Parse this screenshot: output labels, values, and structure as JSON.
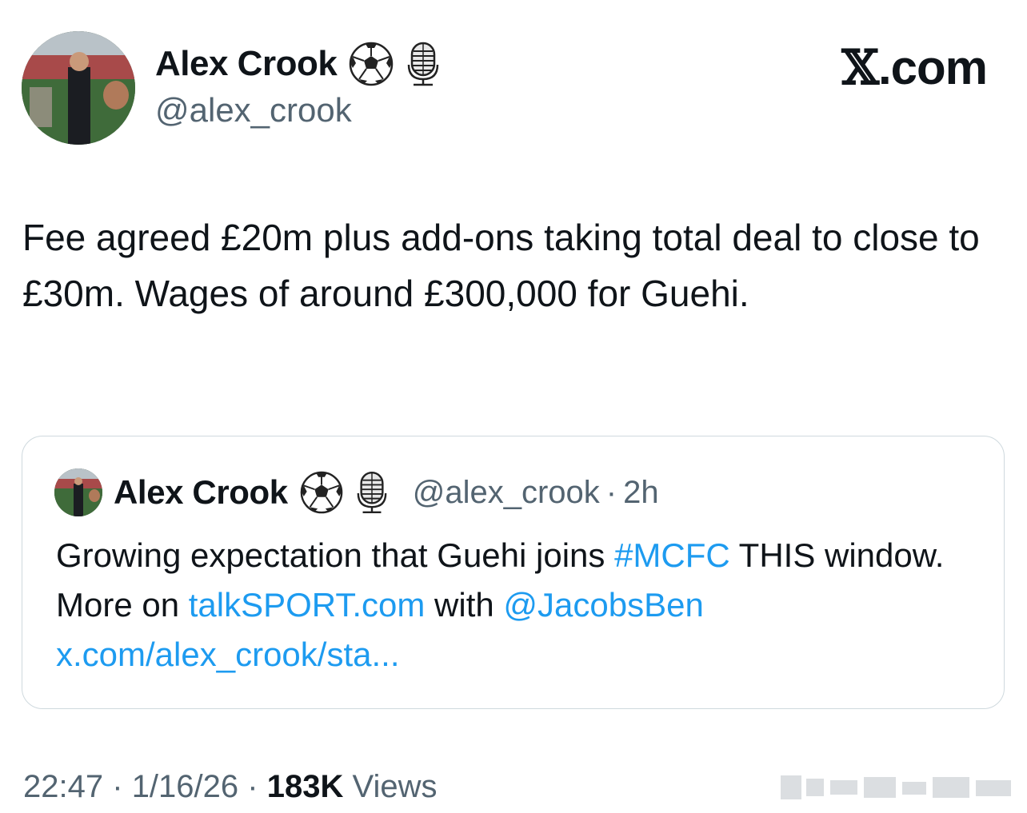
{
  "author": {
    "display_name": "Alex Crook",
    "handle": "@alex_crook",
    "badges": [
      "soccer-ball-icon",
      "microphone-icon"
    ]
  },
  "brand": {
    "text": ".com",
    "glyph": "𝕏"
  },
  "tweet": {
    "text": "Fee agreed £20m plus add-ons taking total deal to close to £30m. Wages of around £300,000 for Guehi."
  },
  "quoted": {
    "display_name": "Alex Crook",
    "handle": "@alex_crook",
    "separator": "·",
    "time": "2h",
    "text_1": "Growing expectation that Guehi joins ",
    "hashtag": "#MCFC",
    "text_2": " THIS window. More on ",
    "link_site": "talkSPORT.com",
    "text_3": " with ",
    "mention": "@JacobsBen",
    "link_status": "x.com/alex_crook/sta..."
  },
  "meta": {
    "time": "22:47",
    "sep": "·",
    "date": "1/16/26",
    "views_count": "183K",
    "views_label": "Views"
  },
  "colors": {
    "text": "#0f1419",
    "secondary": "#536471",
    "link": "#1d9bf0",
    "border": "#cfd9de"
  }
}
